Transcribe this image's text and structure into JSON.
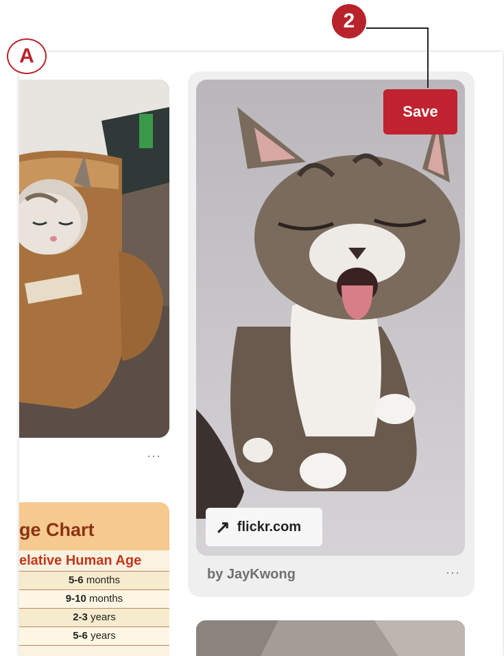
{
  "annotations": {
    "label_a": "A",
    "callout_2": "2"
  },
  "left_column": {
    "more_label": "···",
    "age_chart": {
      "title": "ge Chart",
      "subtitle": "elative Human Age",
      "rows": [
        {
          "value": "5-6",
          "unit": " months"
        },
        {
          "value": "9-10",
          "unit": " months"
        },
        {
          "value": "2-3",
          "unit": " years"
        },
        {
          "value": "5-6",
          "unit": " years"
        }
      ]
    }
  },
  "right_pin": {
    "save_label": "Save",
    "link_icon": "arrow-up-right-icon",
    "link_text": "flickr.com",
    "byline": "by JayKwong",
    "more_label": "···"
  },
  "colors": {
    "accent": "#c0232f",
    "callout": "#b8232b"
  }
}
